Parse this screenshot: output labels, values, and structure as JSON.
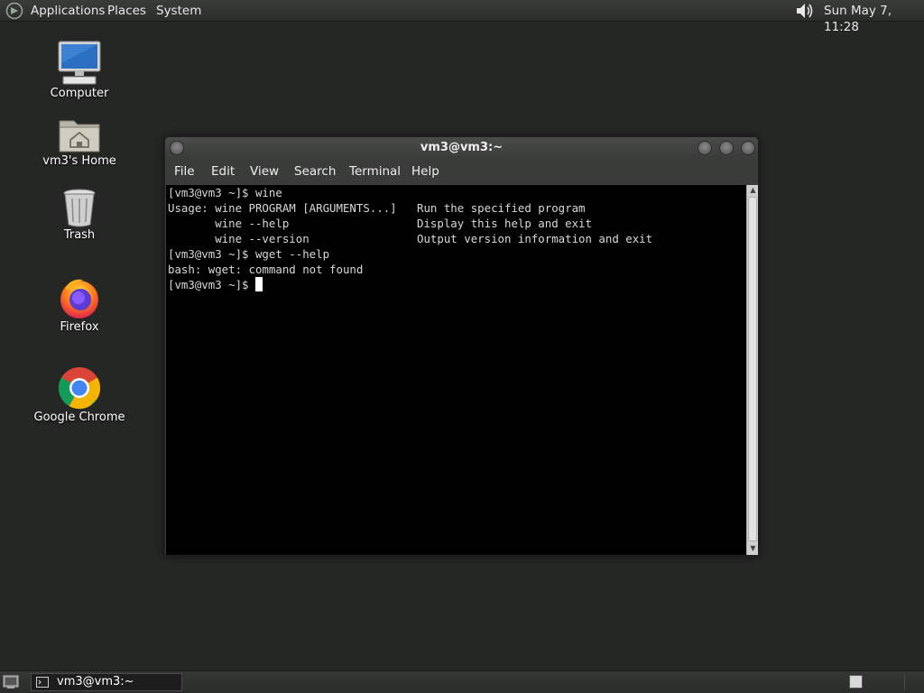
{
  "top_panel": {
    "menus": [
      "Applications",
      "Places",
      "System"
    ],
    "clock": "Sun May  7, 11:28"
  },
  "desktop": {
    "icons": [
      {
        "label": "Computer",
        "icon": "computer-icon"
      },
      {
        "label": "vm3's Home",
        "icon": "home-folder-icon"
      },
      {
        "label": "Trash",
        "icon": "trash-icon"
      },
      {
        "label": "Firefox",
        "icon": "firefox-icon"
      },
      {
        "label": "Google Chrome",
        "icon": "chrome-icon"
      }
    ]
  },
  "terminal": {
    "title": "vm3@vm3:~",
    "menu": [
      "File",
      "Edit",
      "View",
      "Search",
      "Terminal",
      "Help"
    ],
    "lines": [
      "[vm3@vm3 ~]$ wine",
      "Usage: wine PROGRAM [ARGUMENTS...]   Run the specified program",
      "       wine --help                   Display this help and exit",
      "       wine --version                Output version information and exit",
      "[vm3@vm3 ~]$ wget --help",
      "bash: wget: command not found"
    ],
    "prompt": "[vm3@vm3 ~]$ "
  },
  "taskbar": {
    "tasks": [
      {
        "label": "vm3@vm3:~",
        "icon": "terminal-icon"
      }
    ]
  },
  "colors": {
    "desktop_bg": "#252725",
    "panel_bg": "#2f312f",
    "terminal_bg": "#000000",
    "terminal_fg": "#d8d8d8"
  }
}
